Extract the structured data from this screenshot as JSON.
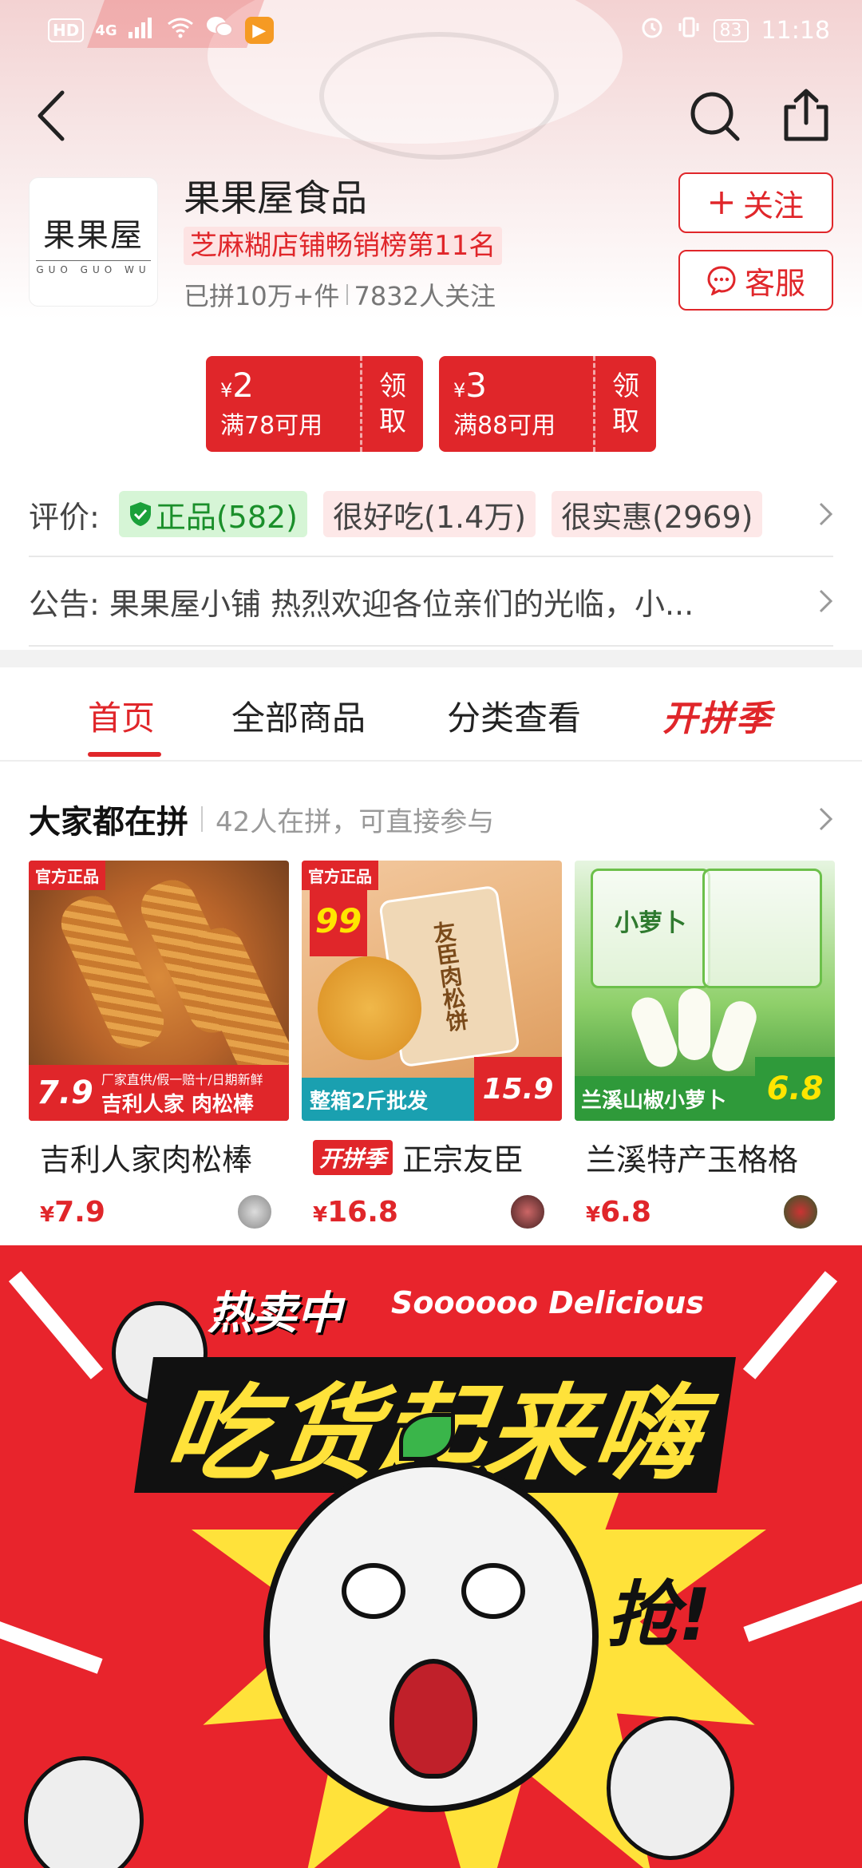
{
  "status_bar": {
    "left_chip": "HD",
    "network": "4G",
    "battery": "83",
    "time": "11:18"
  },
  "shop": {
    "logo_text": "果果屋",
    "logo_sub": "GUO GUO WU",
    "name": "果果屋食品",
    "rank_badge": "芝麻糊店铺畅销榜第11名",
    "sold": "已拼10万+件",
    "followers": "7832人关注",
    "follow_label": "关注",
    "service_label": "客服"
  },
  "coupons": [
    {
      "currency": "¥",
      "amount": "2",
      "condition": "满78可用",
      "claim_1": "领",
      "claim_2": "取"
    },
    {
      "currency": "¥",
      "amount": "3",
      "condition": "满88可用",
      "claim_1": "领",
      "claim_2": "取"
    }
  ],
  "reviews": {
    "label": "评价:",
    "tags": [
      {
        "text": "正品(582)",
        "style": "green",
        "icon": "shield-check-icon"
      },
      {
        "text": "很好吃(1.4万)",
        "style": "pink"
      },
      {
        "text": "很实惠(2969)",
        "style": "pink"
      }
    ]
  },
  "notice": {
    "text": "公告: 果果屋小铺 热烈欢迎各位亲们的光临，小..."
  },
  "tabs": {
    "items": [
      "首页",
      "全部商品",
      "分类查看"
    ],
    "active": "首页",
    "season": "开拼季"
  },
  "group": {
    "title": "大家都在拼",
    "subtitle": "42人在拼，可直接参与"
  },
  "products": [
    {
      "name": "吉利人家肉松棒",
      "currency": "¥",
      "price": "7.9",
      "img_tag": "官方正品",
      "img_price": "7.9",
      "img_caption": "吉利人家 肉松棒",
      "img_small": "厂家直供/假一赔十/日期新鲜"
    },
    {
      "name": "正宗友臣",
      "season_tag": "开拼季",
      "currency": "¥",
      "price": "16.8",
      "img_tag": "官方正品",
      "img_badge": "99",
      "img_caption": "整箱2斤批发",
      "img_price": "15.9",
      "img_pack": "友臣肉松饼"
    },
    {
      "name": "兰溪特产玉格格",
      "currency": "¥",
      "price": "6.8",
      "img_caption": "兰溪山椒小萝卜",
      "img_price": "6.8",
      "img_bag": "小萝卜"
    }
  ],
  "banner": {
    "hot": "热卖中",
    "english": "Soooooo Delicious",
    "slogan": "吃货起来嗨",
    "grab": "抢!"
  },
  "colors": {
    "accent": "#e0262a",
    "green_tag": "#1a8f2a",
    "banner_yellow": "#ffe23a"
  }
}
